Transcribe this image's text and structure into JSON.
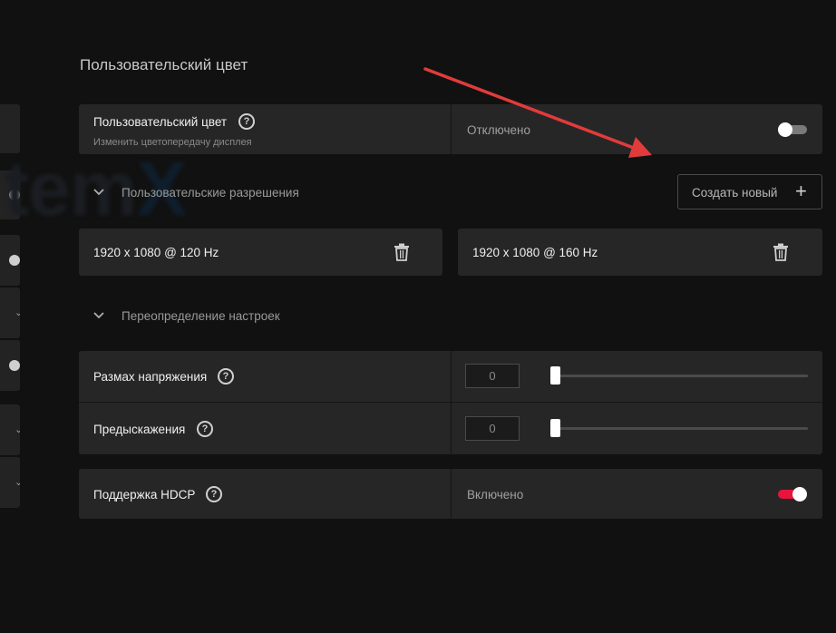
{
  "watermark": {
    "part1": "tem",
    "part2": "X"
  },
  "section": {
    "title": "Пользовательский цвет"
  },
  "custom_color": {
    "label": "Пользовательский цвет",
    "description": "Изменить цветопередачу дисплея",
    "status": "Отключено",
    "enabled": false
  },
  "custom_resolutions": {
    "header": "Пользовательские разрешения",
    "create_button": "Создать новый",
    "create_icon": "plus-icon",
    "items": [
      {
        "value": "1920 x 1080 @ 120 Hz",
        "icon": "trash-icon"
      },
      {
        "value": "1920 x 1080 @ 160 Hz",
        "icon": "trash-icon"
      }
    ]
  },
  "overrides": {
    "header": "Переопределение настроек",
    "voltage_swing": {
      "label": "Размах напряжения",
      "value": "0",
      "slider_fraction": 0
    },
    "pre_emphasis": {
      "label": "Предыскажения",
      "value": "0",
      "slider_fraction": 0
    }
  },
  "hdcp": {
    "label": "Поддержка HDCP",
    "status": "Включено",
    "enabled": true
  },
  "colors": {
    "accent": "#e8143c",
    "toggle_off_track": "#7a7a7a",
    "annotation_arrow": "#e23b3b"
  }
}
